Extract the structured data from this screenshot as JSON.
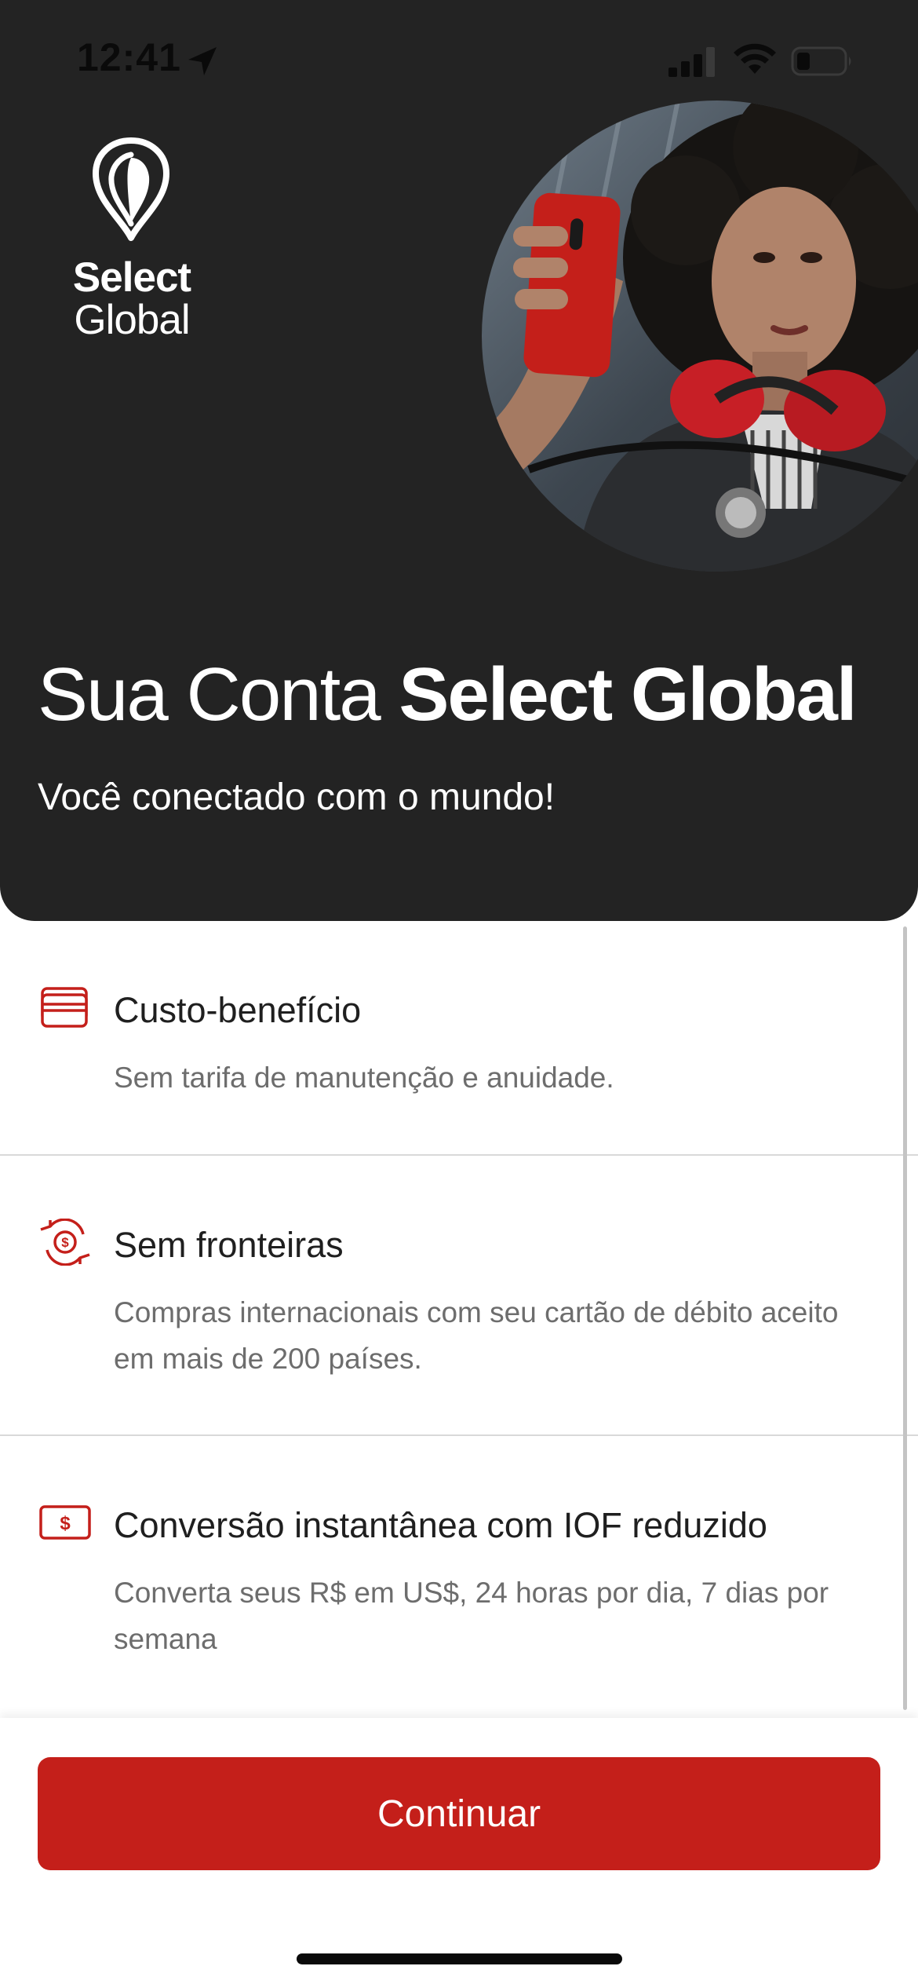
{
  "status_bar": {
    "time": "12:41",
    "icons": [
      "location-arrow-icon",
      "cellular-signal-icon",
      "wifi-icon",
      "battery-icon"
    ]
  },
  "brand": {
    "logo_line1": "Select",
    "logo_line2": "Global"
  },
  "hero": {
    "title_regular": "Sua Conta ",
    "title_bold": "Select Global",
    "subtitle": "Você conectado com o mundo!",
    "photo": "woman-taking-selfie-with-red-phone"
  },
  "features": [
    {
      "icon": "card-icon",
      "title": "Custo-benefício",
      "description": "Sem tarifa de manutenção e anuidade."
    },
    {
      "icon": "currency-exchange-icon",
      "title": "Sem fronteiras",
      "description": "Compras internacionais com seu cartão de débito aceito em mais de 200 países."
    },
    {
      "icon": "dollar-bill-icon",
      "title": "Conversão instantânea com IOF reduzido",
      "description": "Converta seus R$ em US$, 24 horas por dia, 7 dias por semana"
    }
  ],
  "footer": {
    "continue_label": "Continuar"
  },
  "colors": {
    "hero_background": "#232323",
    "accent": "#c41f1a",
    "title_text": "#1f1f1f",
    "description_text": "#6d6d6d",
    "divider": "#d9d9d9"
  }
}
